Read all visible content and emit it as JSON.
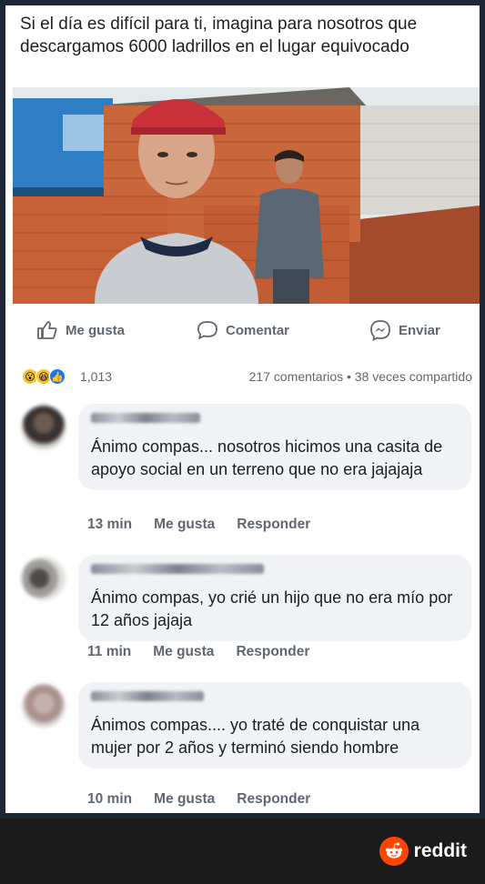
{
  "post": {
    "caption": "Si el día es difícil para ti, imagina para nosotros que descargamos 6000 ladrillos en el lugar equivocado"
  },
  "actions": {
    "like": "Me gusta",
    "comment": "Comentar",
    "send": "Enviar"
  },
  "stats": {
    "reactions_count": "1,013",
    "comments_shares": "217 comentarios • 38 veces compartido"
  },
  "comments": [
    {
      "text": "Ánimo compas... nosotros hicimos una casita de apoyo social en un terreno que no era jajajaja",
      "time": "13 min",
      "like": "Me gusta",
      "reply": "Responder"
    },
    {
      "text": "Ánimo compas, yo crié un hijo que no era mío por 12 años jajaja",
      "time": "11 min",
      "like": "Me gusta",
      "reply": "Responder"
    },
    {
      "text": "Ánimos compas.... yo traté de conquistar una mujer por 2 años y terminó siendo hombre",
      "time": "10 min",
      "like": "Me gusta",
      "reply": "Responder"
    }
  ],
  "footer": {
    "brand": "reddit"
  },
  "colors": {
    "facebook_blue": "#1877f2",
    "meta_gray": "#606770",
    "bubble_bg": "#f0f2f5",
    "reddit_orange": "#ff4500"
  },
  "icons": {
    "like": "thumbs-up-icon",
    "comment": "speech-bubble-icon",
    "send": "messenger-icon"
  }
}
